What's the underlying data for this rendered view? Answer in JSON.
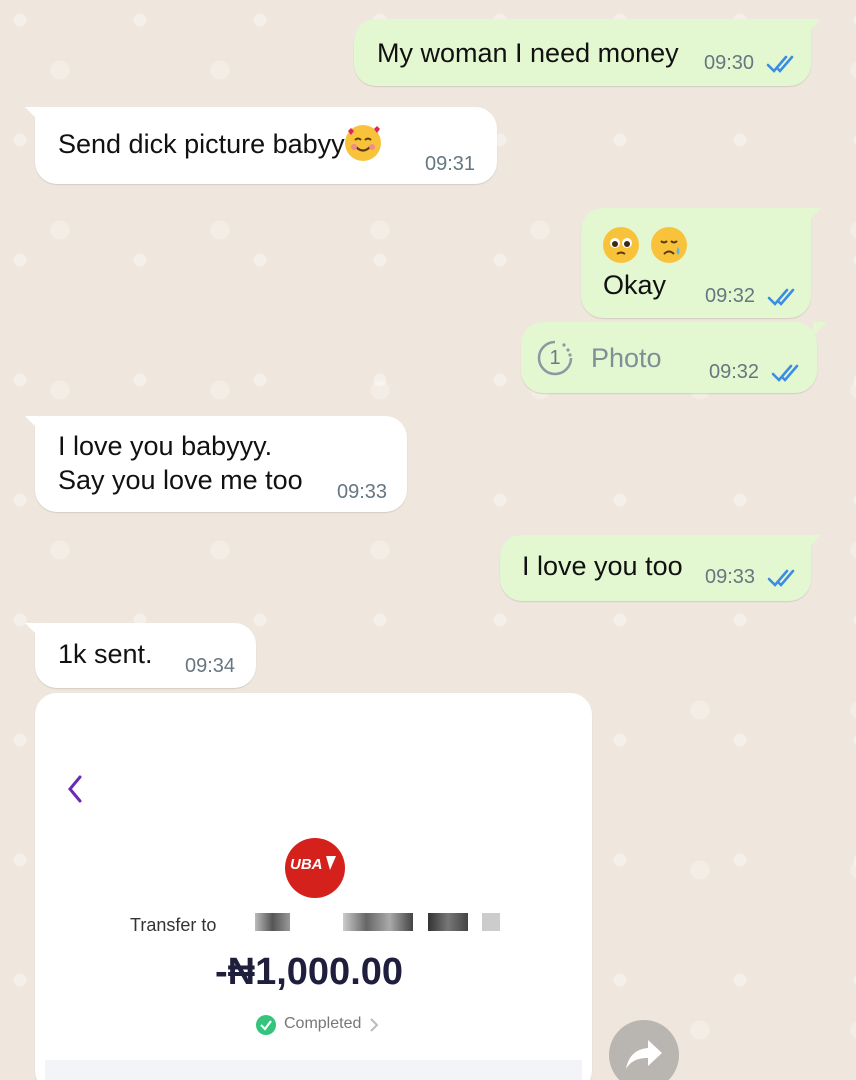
{
  "messages": [
    {
      "direction": "out",
      "text": "My woman I need money",
      "time": "09:30",
      "status": "read"
    },
    {
      "direction": "in",
      "text": "Send dick picture babyy",
      "emoji": "smiling-face-with-hearts",
      "time": "09:31"
    },
    {
      "direction": "out",
      "emojis": [
        "pleading-face",
        "crying-face"
      ],
      "text": "Okay",
      "time": "09:32",
      "status": "read"
    },
    {
      "direction": "out",
      "type": "view-once-photo",
      "badge": "1",
      "text": "Photo",
      "time": "09:32",
      "status": "read"
    },
    {
      "direction": "in",
      "lines": [
        "I love you babyyy.",
        "Say you love me too"
      ],
      "time": "09:33"
    },
    {
      "direction": "out",
      "text": "I love you too",
      "time": "09:33",
      "status": "read"
    },
    {
      "direction": "in",
      "text": "1k sent.",
      "time": "09:34"
    }
  ],
  "receipt": {
    "bank_logo_text": "UBA",
    "transfer_label": "Transfer to",
    "amount": "-₦1,000.00",
    "status": "Completed"
  },
  "colors": {
    "outgoing_bubble": "#e3f8d1",
    "incoming_bubble": "#ffffff",
    "read_ticks": "#3b8de3",
    "receipt_accent": "#6a2bb5",
    "bank_red": "#d4211c",
    "completed_green": "#34c47c",
    "amount_text": "#1f1f3d"
  },
  "icons": {
    "read_receipt": "double-check-icon",
    "view_once": "view-once-1-icon",
    "back": "chevron-left-icon",
    "status_ok": "check-circle-icon",
    "status_more": "chevron-right-icon",
    "forward": "forward-arrow-icon"
  }
}
